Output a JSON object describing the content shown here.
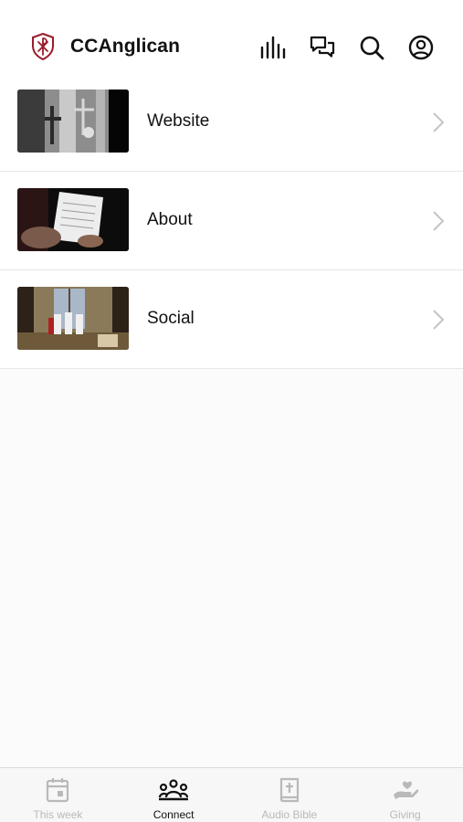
{
  "header": {
    "app_name": "CCAnglican",
    "logo_icon": "shield-cross-logo",
    "brand_color": "#9b1b2a",
    "actions": [
      {
        "icon": "bar-chart-icon"
      },
      {
        "icon": "chat-bubbles-icon"
      },
      {
        "icon": "search-icon"
      },
      {
        "icon": "user-profile-icon"
      }
    ]
  },
  "list": {
    "items": [
      {
        "label": "Website",
        "thumbnail": "church-cross-altar-photo"
      },
      {
        "label": "About",
        "thumbnail": "hands-holding-paper-photo"
      },
      {
        "label": "Social",
        "thumbnail": "people-in-church-photo"
      }
    ]
  },
  "tabbar": {
    "tabs": [
      {
        "label": "This week",
        "icon": "calendar-icon",
        "active": false
      },
      {
        "label": "Connect",
        "icon": "people-group-icon",
        "active": true
      },
      {
        "label": "Audio Bible",
        "icon": "bible-icon",
        "active": false
      },
      {
        "label": "Giving",
        "icon": "giving-hand-icon",
        "active": false
      }
    ],
    "active_color": "#111111",
    "inactive_color": "#b9b9b9"
  }
}
